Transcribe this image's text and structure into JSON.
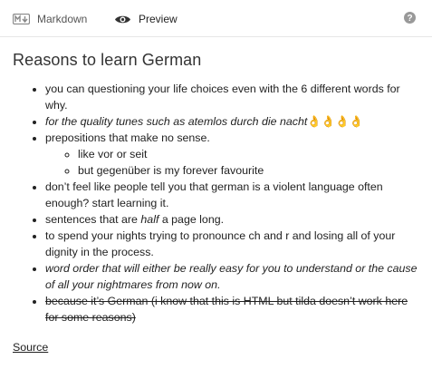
{
  "toolbar": {
    "markdown_tab": "Markdown",
    "preview_tab": "Preview",
    "markdown_icon": "markdown-icon",
    "preview_icon": "eye-icon",
    "help_icon": "help-icon"
  },
  "content": {
    "title": "Reasons to learn German",
    "items": [
      "you can questioning your life choices even with the 6 different words for why.",
      "for the quality tunes such as atemlos durch die nacht",
      "prepositions that make no sense.",
      "don’t feel like people tell you that german is a violent language often enough? start learning it.",
      "sentences that are",
      "to spend your nights trying to pronounce ch and r and losing all of your dignity in the process.",
      "word order that will either be really easy for you to understand or the cause of all your nightmares from now on.",
      "because it’s German (i know that this is HTML but tilda doesn’t work here for some reasons)"
    ],
    "emoji": "👌👌👌👌",
    "sub_items": [
      "like vor or seit",
      "but gegenüber is my forever favourite"
    ],
    "half_word": "half",
    "sentences_tail": " a page long.",
    "source_link": "Source"
  },
  "colors": {
    "toolbar_border": "#e6e6e6",
    "text": "#222222",
    "muted_text": "#555555"
  }
}
